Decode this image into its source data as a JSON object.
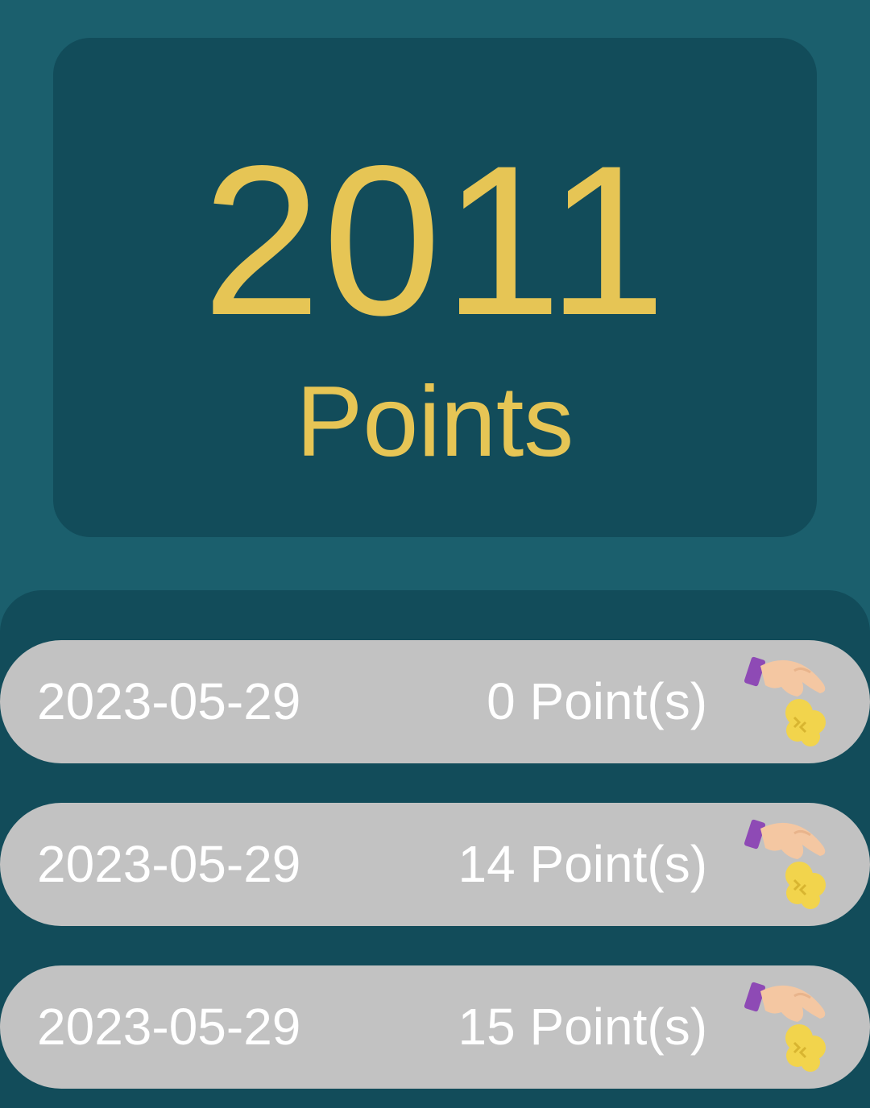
{
  "summary": {
    "total": "2011",
    "caption": "Points"
  },
  "history": [
    {
      "date": "2023-05-29",
      "points": "0 Point(s)",
      "icon": "hand-dropping-coins-icon"
    },
    {
      "date": "2023-05-29",
      "points": "14 Point(s)",
      "icon": "hand-dropping-coins-icon"
    },
    {
      "date": "2023-05-29",
      "points": "15 Point(s)",
      "icon": "hand-dropping-coins-icon"
    }
  ],
  "colors": {
    "background": "#1b5f6d",
    "card": "#124c5a",
    "accent": "#e6c555",
    "row": "#c2c2c2",
    "row_text": "#ffffff"
  }
}
